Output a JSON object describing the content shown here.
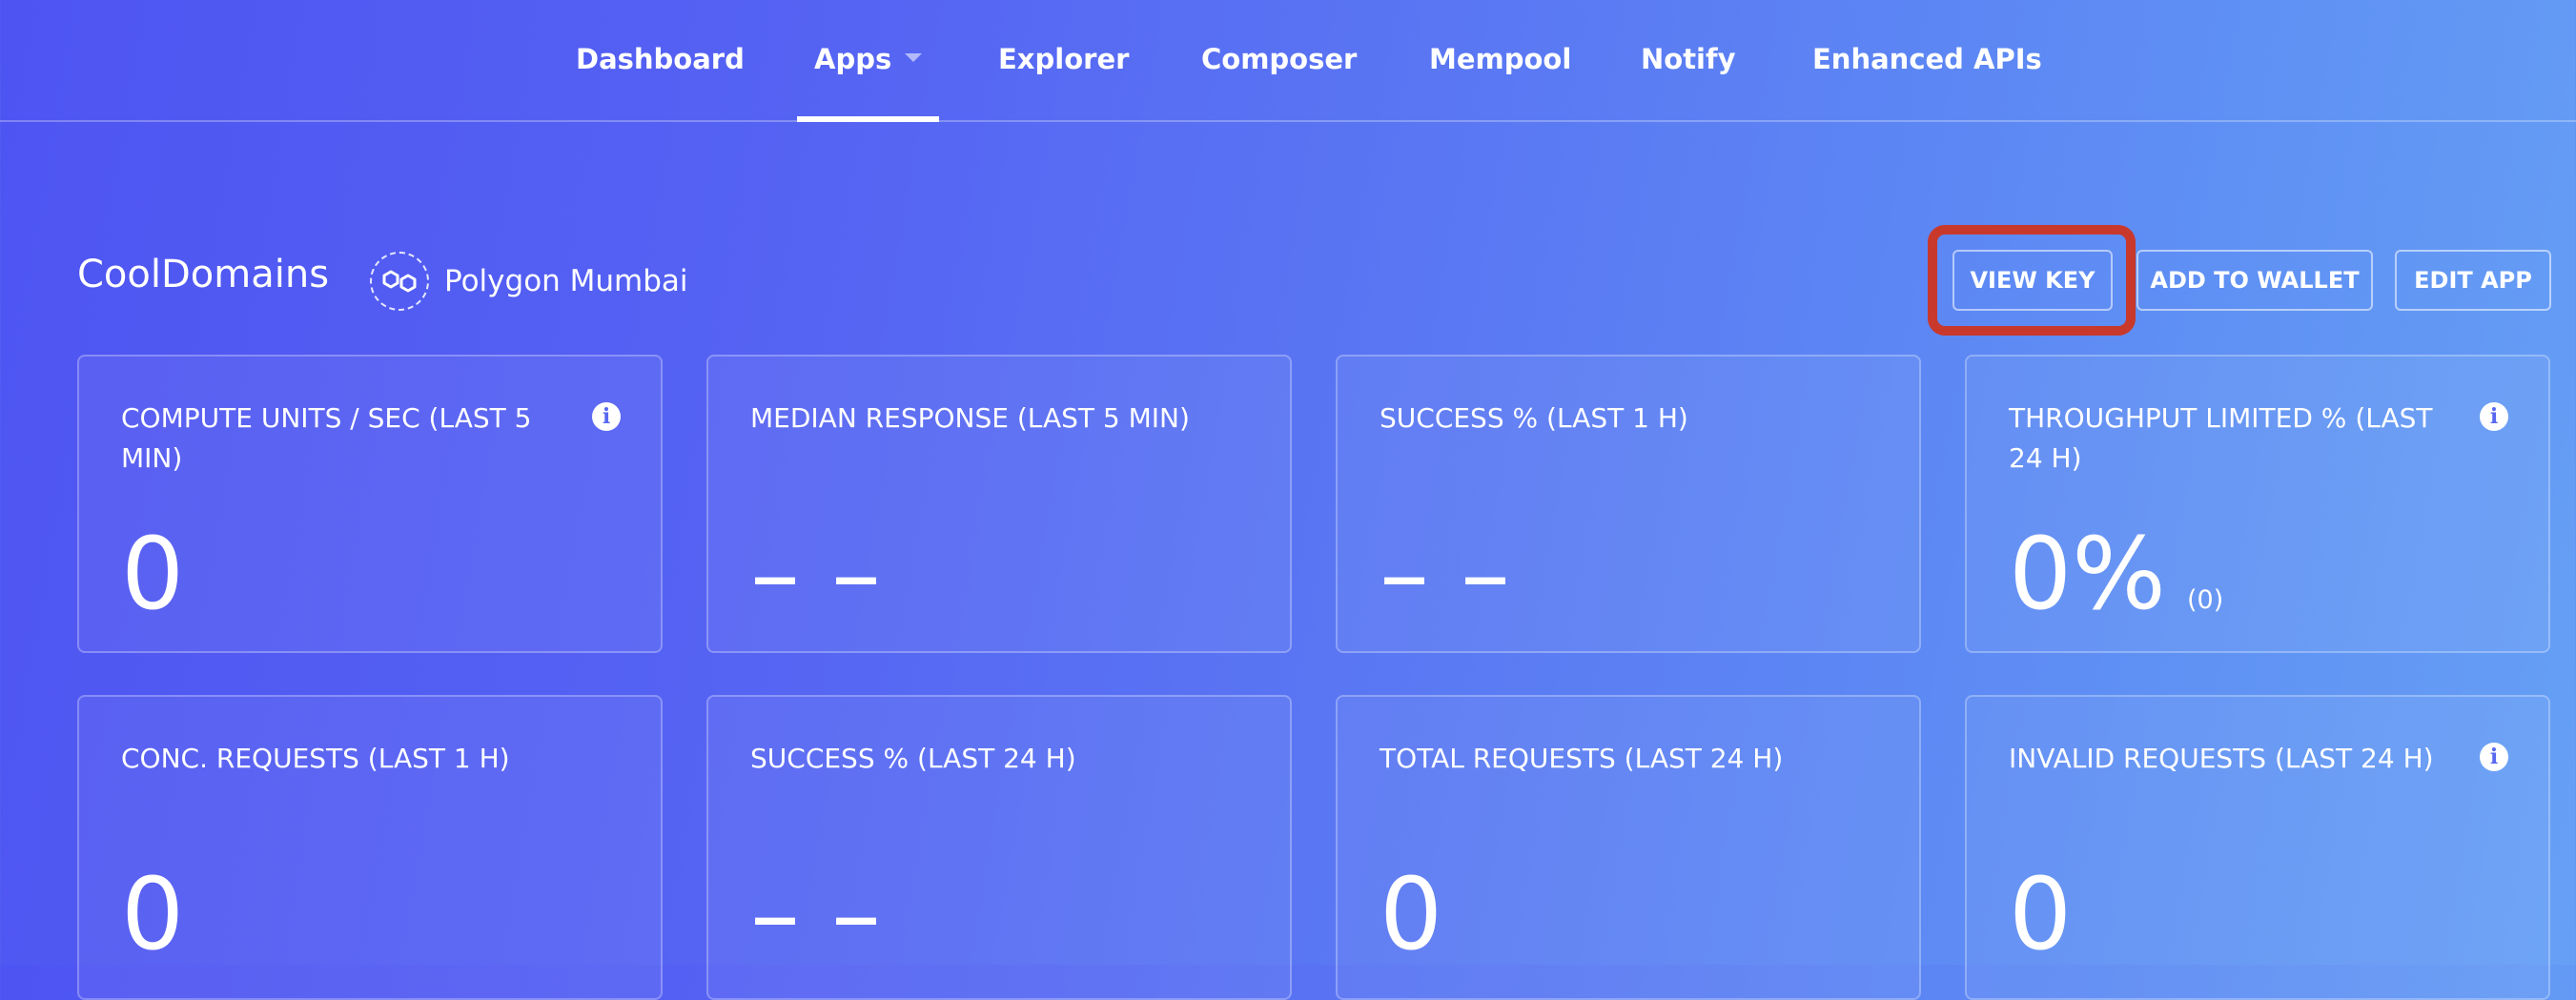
{
  "nav": {
    "items": [
      {
        "label": "Dashboard"
      },
      {
        "label": "Apps"
      },
      {
        "label": "Explorer"
      },
      {
        "label": "Composer"
      },
      {
        "label": "Mempool"
      },
      {
        "label": "Notify"
      },
      {
        "label": "Enhanced APIs"
      }
    ],
    "active": "Apps"
  },
  "app": {
    "name": "CoolDomains",
    "network": "Polygon Mumbai",
    "network_icon": "polygon-icon"
  },
  "actions": {
    "view_key": "VIEW KEY",
    "add_to_wallet": "ADD TO WALLET",
    "edit_app": "EDIT APP"
  },
  "stats": [
    {
      "label": "COMPUTE UNITS / SEC (LAST 5 MIN)",
      "value": "0",
      "info": true
    },
    {
      "label": "MEDIAN RESPONSE (LAST 5 MIN)",
      "value": "– –",
      "info": false
    },
    {
      "label": "SUCCESS % (LAST 1 H)",
      "value": "– –",
      "info": false
    },
    {
      "label": "THROUGHPUT LIMITED % (LAST 24 H)",
      "value": "0%",
      "sub": "(0)",
      "info": true
    },
    {
      "label": "CONC. REQUESTS (LAST 1 H)",
      "value": "0",
      "info": false
    },
    {
      "label": "SUCCESS % (LAST 24 H)",
      "value": "– –",
      "info": false
    },
    {
      "label": "TOTAL REQUESTS (LAST 24 H)",
      "value": "0",
      "info": false
    },
    {
      "label": "INVALID REQUESTS (LAST 24 H)",
      "value": "0",
      "info": true
    }
  ],
  "colors": {
    "highlight": "#c8392c",
    "gradient_start": "#4e54f2",
    "gradient_end": "#66a0f5"
  }
}
